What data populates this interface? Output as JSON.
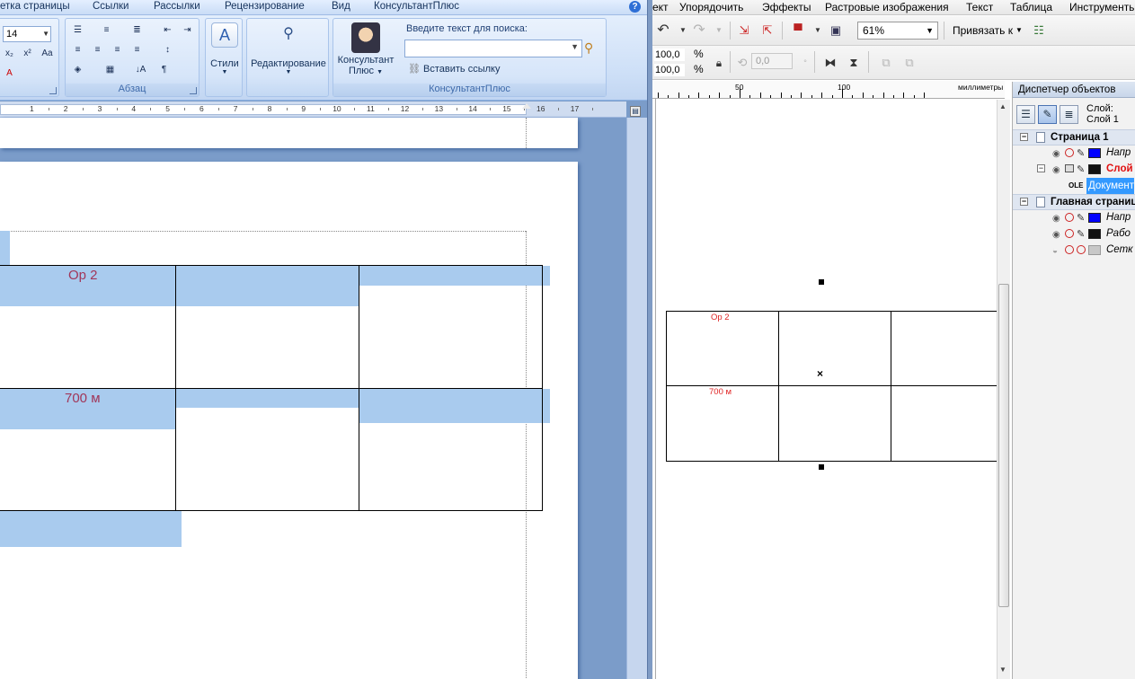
{
  "word": {
    "menubar_tabs": [
      "етка страницы",
      "Ссылки",
      "Рассылки",
      "Рецензирование",
      "Вид",
      "КонсультантПлюс"
    ],
    "ribbon": {
      "font_size": "14",
      "paragraph_caption": "Абзац",
      "styles_label": "Стили",
      "editing_label": "Редактирование",
      "konsultant_label_1": "Консультант",
      "konsultant_label_2": "Плюс",
      "search_label": "Введите текст для поиска:",
      "search_value": "",
      "insert_link_label": "Вставить ссылку",
      "konsultant_caption": "КонсультантПлюс"
    },
    "ruler_numbers": [
      "1",
      "2",
      "3",
      "4",
      "5",
      "6",
      "7",
      "8",
      "9",
      "10",
      "11",
      "12",
      "13",
      "14",
      "15",
      "16",
      "17"
    ],
    "table": {
      "rows": [
        [
          "Ор 2",
          "",
          ""
        ],
        [
          "700 м",
          "",
          ""
        ]
      ]
    },
    "colors": {
      "selection": "#a9cbee",
      "cell_text": "#a13659"
    }
  },
  "corel": {
    "menubar": [
      "ект",
      "Упорядочить",
      "Эффекты",
      "Растровые изображения",
      "Текст",
      "Таблица",
      "Инструменты"
    ],
    "toolbar": {
      "zoom": "61%",
      "snap_label": "Привязать к",
      "scale_x": "100,0",
      "scale_y": "100,0",
      "pct_unit": "%",
      "rotation": "0,0"
    },
    "ruler": {
      "labels": [
        "50",
        "100"
      ],
      "units": "миллиметры"
    },
    "table": {
      "rows": [
        [
          "Ор 2",
          "",
          ""
        ],
        [
          "700 м",
          "",
          ""
        ]
      ]
    },
    "object_manager": {
      "title": "Диспетчер объектов",
      "layer_label": "Слой:",
      "layer_value": "Слой 1",
      "tree": [
        {
          "type": "page",
          "name": "Страница 1"
        },
        {
          "type": "layer",
          "name": "Напр",
          "color": "#0000ff"
        },
        {
          "type": "layer",
          "name": "Слой",
          "color": "#111111",
          "active": true
        },
        {
          "type": "object",
          "tag": "OLE",
          "name": "Документ"
        },
        {
          "type": "page",
          "name": "Главная страниц"
        },
        {
          "type": "layer",
          "name": "Напр",
          "color": "#0000ff"
        },
        {
          "type": "layer",
          "name": "Рабо",
          "color": "#111111"
        },
        {
          "type": "layer",
          "name": "Сетк",
          "color": "#c8c8c8"
        }
      ]
    }
  }
}
